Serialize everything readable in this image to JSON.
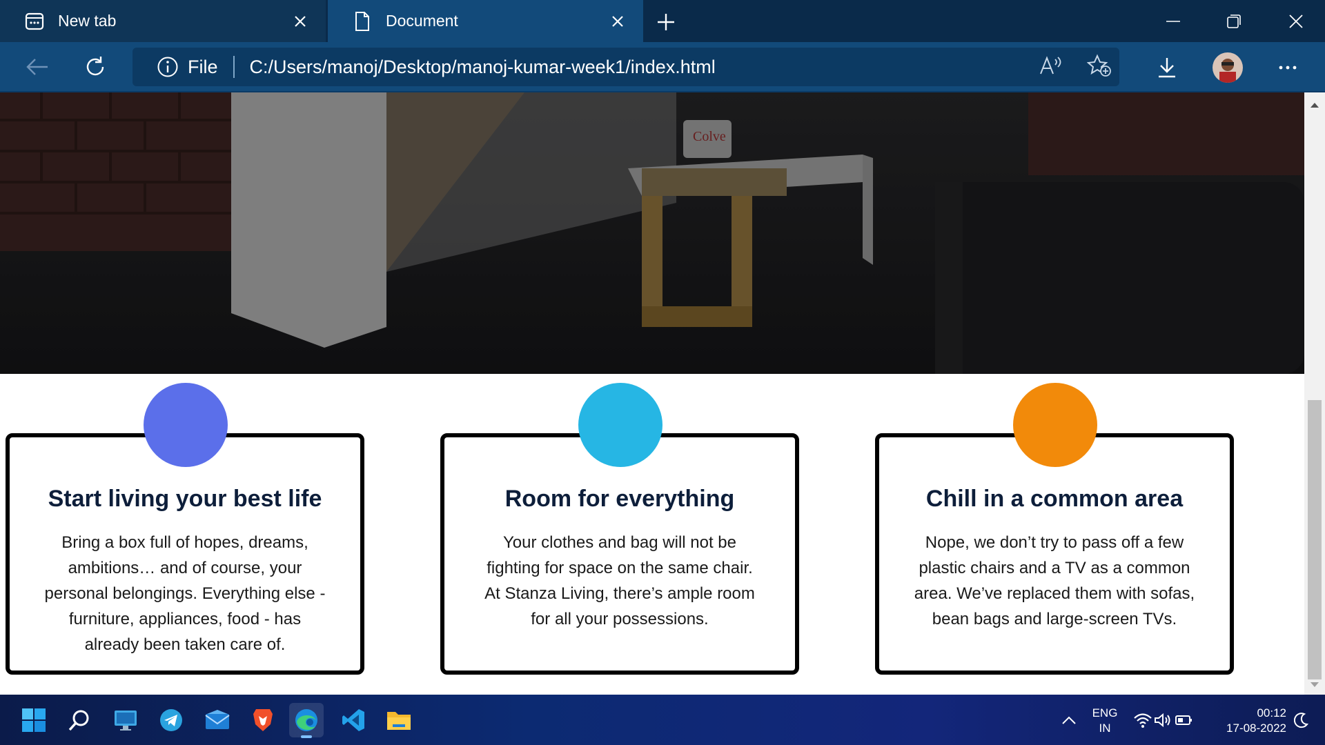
{
  "browser": {
    "tabs": [
      {
        "title": "New tab",
        "active": false
      },
      {
        "title": "Document",
        "active": true
      }
    ],
    "address": {
      "scheme_label": "File",
      "url": "C:/Users/manoj/Desktop/manoj-kumar-week1/index.html"
    }
  },
  "hero": {
    "mug_text": "Colve",
    "image_description_icon": "photo"
  },
  "cards": [
    {
      "title": "Start living your best life",
      "text": "Bring a box full of hopes, dreams, ambitions… and of course, your personal belongings. Everything else - furniture, appliances, food - has already been taken care of.",
      "circle_color": "#5b6fea"
    },
    {
      "title": "Room for everything",
      "text": "Your clothes and bag will not be fighting for space on the same chair. At Stanza Living, there’s ample room for all your possessions.",
      "circle_color": "#26b6e4"
    },
    {
      "title": "Chill in a common area",
      "text": "Nope, we don’t try to pass off a few plastic chairs and a TV as a common area. We’ve replaced them with sofas, bean bags and large-screen TVs.",
      "circle_color": "#f28a0a"
    }
  ],
  "taskbar": {
    "apps": [
      "start-icon",
      "search-icon",
      "desktop-icon",
      "telegram-icon",
      "mail-icon",
      "brave-icon",
      "edge-icon",
      "vscode-icon",
      "file-explorer-icon"
    ],
    "language_top": "ENG",
    "language_bottom": "IN",
    "time": "00:12",
    "date": "17-08-2022"
  },
  "colors": {
    "tabstrip": "#0a2a4a",
    "toolbar": "#124a7a",
    "card_title": "#0d1e3a"
  }
}
